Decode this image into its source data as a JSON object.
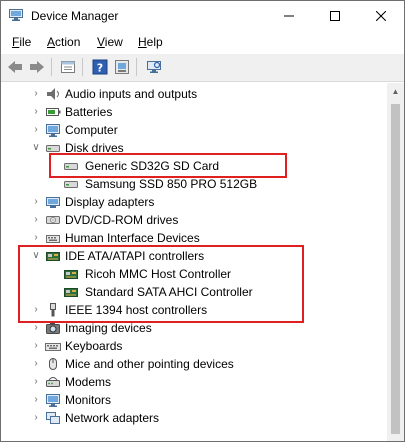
{
  "window": {
    "title": "Device Manager"
  },
  "menu": [
    {
      "label": "File",
      "mnemonic": "F",
      "rest": "ile"
    },
    {
      "label": "Action",
      "mnemonic": "A",
      "rest": "ction"
    },
    {
      "label": "View",
      "mnemonic": "V",
      "rest": "iew"
    },
    {
      "label": "Help",
      "mnemonic": "H",
      "rest": "elp"
    }
  ],
  "toolbar": [
    "back-arrow-icon",
    "forward-arrow-icon",
    "properties-icon",
    "help-icon",
    "update-driver-icon",
    "scan-hardware-icon"
  ],
  "tree": [
    {
      "label": "Audio inputs and outputs",
      "icon": "audio-icon",
      "expanded": false,
      "level": 0
    },
    {
      "label": "Batteries",
      "icon": "battery-icon",
      "expanded": false,
      "level": 0
    },
    {
      "label": "Computer",
      "icon": "computer-icon",
      "expanded": false,
      "level": 0
    },
    {
      "label": "Disk drives",
      "icon": "disk-drive-icon",
      "expanded": true,
      "level": 0
    },
    {
      "label": "Generic SD32G SD Card",
      "icon": "disk-drive-icon",
      "level": 1
    },
    {
      "label": "Samsung SSD 850 PRO 512GB",
      "icon": "disk-drive-icon",
      "level": 1
    },
    {
      "label": "Display adapters",
      "icon": "display-icon",
      "expanded": false,
      "level": 0
    },
    {
      "label": "DVD/CD-ROM drives",
      "icon": "dvd-icon",
      "expanded": false,
      "level": 0
    },
    {
      "label": "Human Interface Devices",
      "icon": "hid-icon",
      "expanded": false,
      "level": 0
    },
    {
      "label": "IDE ATA/ATAPI controllers",
      "icon": "ide-controller-icon",
      "expanded": true,
      "level": 0
    },
    {
      "label": "Ricoh MMC Host Controller",
      "icon": "ide-controller-icon",
      "level": 1
    },
    {
      "label": "Standard SATA AHCI Controller",
      "icon": "ide-controller-icon",
      "level": 1
    },
    {
      "label": "IEEE 1394 host controllers",
      "icon": "ieee1394-icon",
      "expanded": false,
      "level": 0
    },
    {
      "label": "Imaging devices",
      "icon": "camera-icon",
      "expanded": false,
      "level": 0
    },
    {
      "label": "Keyboards",
      "icon": "keyboard-icon",
      "expanded": false,
      "level": 0
    },
    {
      "label": "Mice and other pointing devices",
      "icon": "mouse-icon",
      "expanded": false,
      "level": 0
    },
    {
      "label": "Modems",
      "icon": "modem-icon",
      "expanded": false,
      "level": 0
    },
    {
      "label": "Monitors",
      "icon": "monitor-icon",
      "expanded": false,
      "level": 0
    },
    {
      "label": "Network adapters",
      "icon": "network-icon",
      "expanded": false,
      "level": 0
    }
  ],
  "colors": {
    "highlight": "#e02020",
    "toolbar_bg": "#f0f0f0"
  }
}
